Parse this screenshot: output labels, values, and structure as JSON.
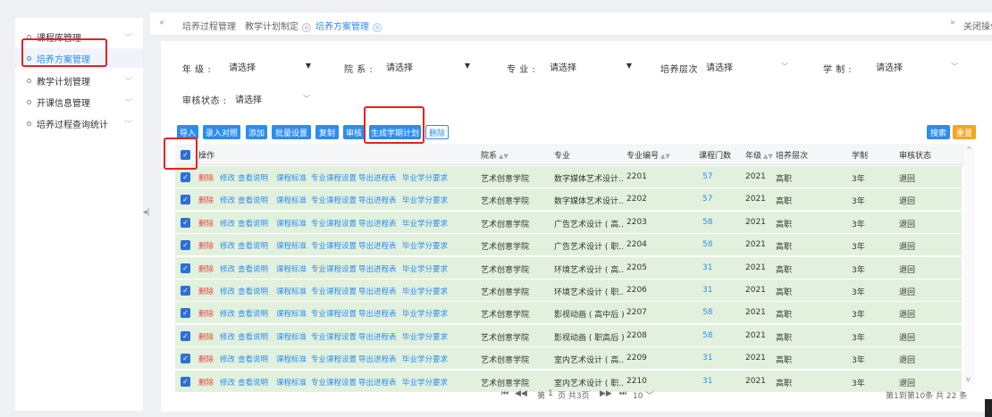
{
  "sidebar": {
    "items": [
      {
        "label": "课程库管理",
        "active": false
      },
      {
        "label": "培养方案管理",
        "active": true
      },
      {
        "label": "教学计划管理",
        "active": false
      },
      {
        "label": "开课信息管理",
        "active": false
      },
      {
        "label": "培养过程查询统计",
        "active": false
      }
    ]
  },
  "tabs": [
    {
      "label": "培养过程管理",
      "closable": false,
      "active": false
    },
    {
      "label": "教学计划制定",
      "closable": true,
      "active": false
    },
    {
      "label": "培养方案管理",
      "closable": true,
      "active": true
    }
  ],
  "tabbar": {
    "close_ops": "关闭操作",
    "close_icon": "⊗"
  },
  "filters": {
    "grade": {
      "label": "年 级 :",
      "value": "请选择"
    },
    "college": {
      "label": "院 系 :",
      "value": "请选择"
    },
    "major": {
      "label": "专 业 :",
      "value": "请选择"
    },
    "level": {
      "label": "培养层次 :",
      "value": "请选择"
    },
    "duration": {
      "label": "学 制 :",
      "value": "请选择"
    },
    "status": {
      "label": "审核状态 :",
      "value": "请选择"
    }
  },
  "toolbar": {
    "import": "导入",
    "entry_compare": "录入对照",
    "add": "添加",
    "batch_set": "批量设置",
    "copy": "复制",
    "review": "审核",
    "gen_plan": "生成学期计划",
    "delete": "删除",
    "search": "搜索",
    "reset": "重置"
  },
  "table": {
    "columns": {
      "ops": "操作",
      "college": "院系",
      "major": "专业",
      "code": "专业编号",
      "courses": "课程门数",
      "grade": "年级",
      "level": "培养层次",
      "duration": "学制",
      "status": "审核状态"
    },
    "actions": {
      "del": "删除",
      "edit": "修改",
      "view": "查看说明",
      "standard": "课程标准",
      "settings": "专业课程设置",
      "export": "导出进程表",
      "credits": "毕业学分要求"
    },
    "rows": [
      {
        "college": "艺术创意学院",
        "major": "数字媒体艺术设计...",
        "code": "2201",
        "courses": "57",
        "grade": "2021",
        "level": "高职",
        "duration": "3年",
        "status": "退回"
      },
      {
        "college": "艺术创意学院",
        "major": "数字媒体艺术设计...",
        "code": "2202",
        "courses": "57",
        "grade": "2021",
        "level": "高职",
        "duration": "3年",
        "status": "退回"
      },
      {
        "college": "艺术创意学院",
        "major": "广告艺术设计 ( 高...",
        "code": "2203",
        "courses": "58",
        "grade": "2021",
        "level": "高职",
        "duration": "3年",
        "status": "退回"
      },
      {
        "college": "艺术创意学院",
        "major": "广告艺术设计 ( 职...",
        "code": "2204",
        "courses": "58",
        "grade": "2021",
        "level": "高职",
        "duration": "3年",
        "status": "退回"
      },
      {
        "college": "艺术创意学院",
        "major": "环境艺术设计 ( 高...",
        "code": "2205",
        "courses": "31",
        "grade": "2021",
        "level": "高职",
        "duration": "3年",
        "status": "退回"
      },
      {
        "college": "艺术创意学院",
        "major": "环境艺术设计 ( 职...",
        "code": "2206",
        "courses": "31",
        "grade": "2021",
        "level": "高职",
        "duration": "3年",
        "status": "退回"
      },
      {
        "college": "艺术创意学院",
        "major": "影视动画 ( 高中后 )",
        "code": "2207",
        "courses": "58",
        "grade": "2021",
        "level": "高职",
        "duration": "3年",
        "status": "退回"
      },
      {
        "college": "艺术创意学院",
        "major": "影视动画 ( 职高后 )",
        "code": "2208",
        "courses": "58",
        "grade": "2021",
        "level": "高职",
        "duration": "3年",
        "status": "退回"
      },
      {
        "college": "艺术创意学院",
        "major": "室内艺术设计 ( 高...",
        "code": "2209",
        "courses": "31",
        "grade": "2021",
        "level": "高职",
        "duration": "3年",
        "status": "退回"
      },
      {
        "college": "艺术创意学院",
        "major": "室内艺术设计 ( 职...",
        "code": "2210",
        "courses": "31",
        "grade": "2021",
        "level": "高职",
        "duration": "3年",
        "status": "退回"
      }
    ]
  },
  "pager": {
    "first": "⏮",
    "prev": "◀◀",
    "page_prefix": "第",
    "page_value": "1",
    "page_suffix": "页 共3页",
    "next": "▶▶",
    "last": "⏭",
    "size": "10",
    "summary": "第1到第10条 共 22 条"
  }
}
